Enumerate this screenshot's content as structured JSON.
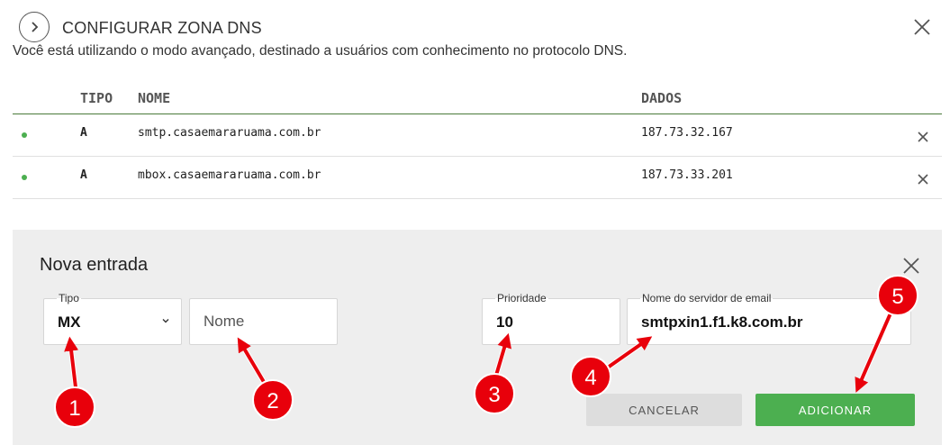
{
  "header": {
    "title": "CONFIGURAR ZONA DNS",
    "subtitle": "Você está utilizando o modo avançado, destinado a usuários com conhecimento no protocolo DNS."
  },
  "table": {
    "columns": [
      "TIPO",
      "NOME",
      "DADOS"
    ],
    "rows": [
      {
        "tipo": "A",
        "nome": "smtp.casaemararuama.com.br",
        "dados": "187.73.32.167"
      },
      {
        "tipo": "A",
        "nome": "mbox.casaemararuama.com.br",
        "dados": "187.73.33.201"
      }
    ]
  },
  "form": {
    "title": "Nova entrada",
    "tipo_label": "Tipo",
    "tipo_value": "MX",
    "nome_placeholder": "Nome",
    "prioridade_label": "Prioridade",
    "prioridade_value": "10",
    "servidor_label": "Nome do servidor de email",
    "servidor_value": "smtpxin1.f1.k8.com.br",
    "cancel_label": "CANCELAR",
    "add_label": "ADICIONAR"
  },
  "annotations": [
    "1",
    "2",
    "3",
    "4",
    "5"
  ],
  "colors": {
    "accent_green": "#4caf50",
    "header_line": "#4a7a3a",
    "annotation_red": "#e8000b",
    "panel_bg": "#eeeeee"
  },
  "icons": [
    "chevron-right-icon",
    "close-icon",
    "status-dot-icon",
    "delete-icon",
    "chevron-down-icon"
  ]
}
